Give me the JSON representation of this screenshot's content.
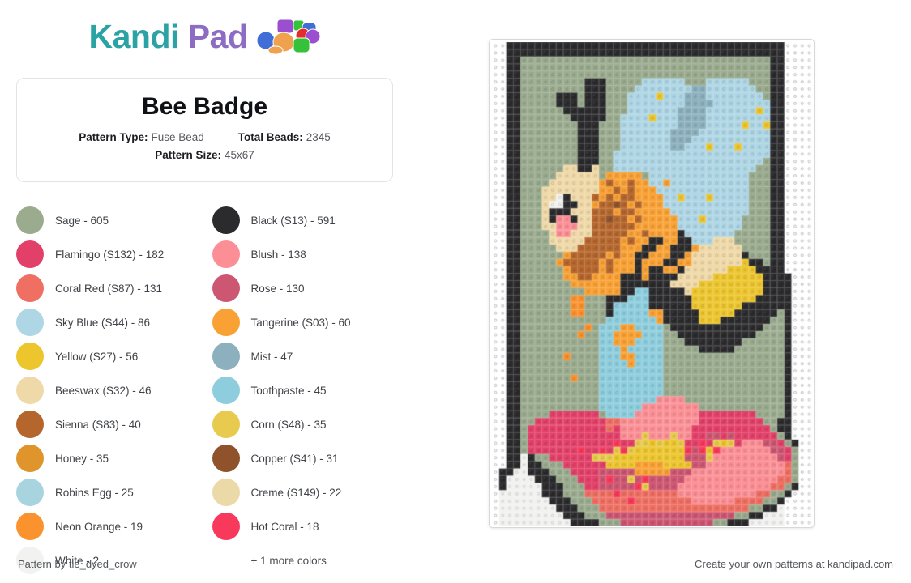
{
  "brand": {
    "name_part1": "Kandi",
    "name_part2": "Pad",
    "color_teal": "#2ba3a5",
    "color_purple": "#8d6dc4"
  },
  "info_card": {
    "title": "Bee Badge",
    "pattern_type_label": "Pattern Type:",
    "pattern_type_value": "Fuse Bead",
    "total_beads_label": "Total Beads:",
    "total_beads_value": "2345",
    "pattern_size_label": "Pattern Size:",
    "pattern_size_value": "45x67"
  },
  "legend": {
    "left": [
      {
        "name": "Sage - 605",
        "color": "#9aab8e"
      },
      {
        "name": "Flamingo (S132) - 182",
        "color": "#e34069"
      },
      {
        "name": "Coral Red (S87) - 131",
        "color": "#ef6f63"
      },
      {
        "name": "Sky Blue (S44) - 86",
        "color": "#aed6e5"
      },
      {
        "name": "Yellow (S27) - 56",
        "color": "#edc62e"
      },
      {
        "name": "Beeswax (S32) - 46",
        "color": "#f0d9a8"
      },
      {
        "name": "Sienna (S83) - 40",
        "color": "#b5662c"
      },
      {
        "name": "Honey - 35",
        "color": "#e0952c"
      },
      {
        "name": "Robins Egg - 25",
        "color": "#a8d4df"
      },
      {
        "name": "Neon Orange - 19",
        "color": "#fa922e"
      },
      {
        "name": "White - 2",
        "color": "#f2f2f0"
      }
    ],
    "right": [
      {
        "name": "Black (S13) - 591",
        "color": "#2b2b2d"
      },
      {
        "name": "Blush - 138",
        "color": "#fb8f95"
      },
      {
        "name": "Rose - 130",
        "color": "#cd5672"
      },
      {
        "name": "Tangerine (S03) - 60",
        "color": "#f9a134"
      },
      {
        "name": "Mist - 47",
        "color": "#8cb0bd"
      },
      {
        "name": "Toothpaste - 45",
        "color": "#8dcddd"
      },
      {
        "name": "Corn (S48) - 35",
        "color": "#e8cb4e"
      },
      {
        "name": "Copper (S41) - 31",
        "color": "#90522a"
      },
      {
        "name": "Creme (S149) - 22",
        "color": "#ecd9a8"
      },
      {
        "name": "Hot Coral - 18",
        "color": "#f9395c"
      }
    ],
    "more_colors": "+ 1 more colors"
  },
  "footer": {
    "left": "Pattern by tie_dyed_crow",
    "right": "Create your own patterns at kandipad.com"
  },
  "pattern": {
    "cols": 45,
    "rows": 67,
    "cell": 8.8,
    "palette": {
      ".": "#ffffff",
      "K": "#2b2b2d",
      "G": "#9aab8e",
      "B": "#aed6e5",
      "M": "#8cb0bd",
      "T": "#8dcddd",
      "R": "#a8d4df",
      "Y": "#edc62e",
      "C": "#e8cb4e",
      "O": "#f9a134",
      "N": "#fa922e",
      "H": "#e0952c",
      "S": "#b5662c",
      "P": "#90522a",
      "W": "#f0d9a8",
      "E": "#ecd9a8",
      "F": "#e34069",
      "L": "#fb8f95",
      "Z": "#cd5672",
      "D": "#ef6f63",
      "X": "#f9395c",
      "I": "#f2f2f0"
    },
    "grid": [
      "..KKKKKKKKKKKKKKKKKKKKKKKKKKKKKKKKKKKKKKK...",
      "..KKKKKKKKKKKKKKKKKKKKKKKKKKKKKKKKKKKKKKK...",
      "..KKGGGGGGGGGGGGGGGGGGGGGGGGGGGGGGGGGGGKK..",
      "..KKGGGGGGGGGGGGGGGGGGGGGGGGGGGGGGGGGGGKK..",
      "..KKGGGGGGGGGGGGGGGGGGGGGGGGGGGGGGGGGGGKK..",
      "..KKGGGGGGGGGKKKGGGGGBBBBBBGGGBBBBBBGGGKK..",
      "..KKGGGGGGGGGKKKGGGGBBBBBBBBMMBBBBBBBGGKK..",
      "..KKGGGGGKKKGKKKGGGBBBBYBBBMMMBBBBBBBBGKK..",
      "..KKGGGGGKKKGKKKGGGBBBBBBBBMMMMBBBBBBBBKK..",
      "..KKGGGGGGKKKKKKGGGBBBBBBBMMMMBBBBBBBYBKK..",
      "..KKGGGGGGGKKKKKGGBBBBYBBBMMMMBBBBBBBBBKK..",
      "..KKGGGGGGGGKKKGGGBBBBBBBBMMMMBBBBBYBBYKK..",
      "..KKGGGGGGGGKKKGGGBBBBBBBMMMMBBBBBBBBBBKK..",
      "..KKGGGGGGGGKKKGGGBBBBBBBMMMBBBBBBBBBBBKK..",
      "..KKGGGGGGGGKKKGGGBBBBBBBMMBBBYBBBYBBBBKK..",
      "..KKGGGGGGGGKKKGGBBBBBBBBBBBBBBBBBBBBBBKK..",
      "..KKGGGGGGGGKKKGGBBBBBBBBBBBBBBBBBBBBBGKK..",
      "..KKGGGGGGWWKKWGGBBBBBBBBBBBBBBBBBBBBGGKK..",
      "..KKGGGGGWWWWWWGOOOOOGBBBBBBBBBBBBBBGGGKK..",
      "..KKGGGGWWWWWWWOSOOSOOBBOBBBBBBBBBBBGGGKK..",
      "..KKGGGWWWWWWWWOOSOSOOOBBBBBBBBBBBBBGGGKK..",
      "..KKGGGWWIKWWWSOSOSSOOOOBBYBBBYBBBBBGGGKK..",
      "..KKGGGWIIKKWWOSSPSOSOOOBBBBBBBBBBBBGGGKK..",
      "..KKGGGWKKKWWWSSSOSSOOOOOBBBBBBBBBBBGGGKK..",
      "..KKGGGWKLLKWWSSPSSOSOOOOOBBBYBBBBBGGGGKK..",
      "..KKGGGWWLLLWWSSSSSSOOOOOOBBBBBBBBBGGGGKK..",
      "..KKGGGGWLLWWWSSSSSOOSOOOOKBBBBBBBGGGGGKK..",
      "..KKGGGGWWWWWSSSSSOSOOKKOOKKBBBWWWGGGGGKK..",
      "..KKGGGGGWWWSSSSSSOOOKKOOKKKOWWWWWWGGGGKK..",
      "..KKGGGGGGOSSSSSOSOOKKOOOKKOWWWWWWWKGGGKK..",
      "..KKGGGGGOSSSSSOSOOOKOOOKKOOWWWWWWWYKKGKK..",
      "..KKGGGGGGOSSSSOSOOOKOKKOOKWWWWWWYYYYKKKK..",
      "..KKGGGGGGOOSSOOOOKKKOKKKKWWWWWYYYYYYYKKKK.",
      "..KKGGGGGGGOOOOOOOKKKKKKKWWWWYYYYYYYYYKKKK.",
      "..KKGGGGGGGGGOOOOOKKTTKKKKKWYYYYYYYYYYKKKK.",
      "..KKGGGGGGGNNGGGKKKTTTKKKKKKYYYYYYYYYKKKKK.",
      "..KKGGGGGGGNNGGGKTTTTTKKKKKKYYYYYYYKKKKKKK.",
      "..KKGGGGGGGNNGGGKTTTTTOOKKKKKYYYYYKKKKKKGK.",
      "..KKGGGGGGGGGGGGTTTTTTTOKKKKKYYYKKKKKKKGGK.",
      "..KKGGGGGGGGGNGTTTOOTTTTGKKKKKKKKKKKKKGGGK.",
      "..KKGGGGGGGGNGGTTOOOOTTTGGKKKKKKKKKKKGGGGK.",
      "..KKGGGGGGGGGGGTTOOOTTTTGGGKKKKKKKKGGGGGGK.",
      "..KKGGGGGGGGGGGTTTOTTTTTGGGGGKKKKKGGGGGGGK.",
      "..KKGGGGGGNGGGGTTTOOTTTTGGGGGGGGGGGGGGGGGK.",
      "..KKGGGGGGGGGGGTTTTOTTTTGGGGGGGGGGGGGGGGGK.",
      "..KKGGGGGGGGGGGTTTTTTTTTGGGGGGGGGGGGGGGGGK.",
      "..KKGGGGGGGNGGGTTTTTTTTTGGGGGGGGGGGGGGGGGK.",
      "..KKGGGGGGGGGGGTTTTTTTTTGGGGGGGGGGGGGGGGGK.",
      "..KKGGGGGGGGGGGTTTTTTTTTGGGGGGGGGGGGGGGGGK.",
      "..KKGGGGGGGGGGGTTTTTTTTLLLLGGGGGGGGGGGGGGK.",
      "..KKGGGGGGGGGGGTTTTTTLLLLLLLLGGGGGGGGGGGGK.",
      "..KKGGGGFFFFFFFGTTTTLLLLLLLLLFFFFFFFFGGGGK.",
      "..KKGGFFFFFFFFFFDDLLLLLLLLLLLFFFFFFFFFGGKK.",
      "..KKGFFFFFFFFFFFDFLLLLLLLLLLFFFFFFFFFFFGKK.",
      "..KKGFFFFFFFFFFFFFLLLCLLLCLLFFZZFZFFFFFFGK.",
      "..KKGFFFFFFFFFFFFXFFCCYCYYCFFXFCYCFLLLZZFGK",
      "..KKGFFFFFFFXFFXFCXCYYYYYYYXZXYXLLLLLLLZZFG",
      "..KKIKGGFFFFFFCCCYYYYYYYYYYZZZCLLLLLLLLLZFG",
      "..KKIKKGGGFFFFFFYYYYOOOOYYYYZZLLLLLLLLLLLDG",
      ".KKIIKKKGGGFFFFZZZZZOOOOOZZZLLLLLLLLLLLLLDG",
      ".KIIIIKKKGGGFFFZXZZCZXZZZZZLLLLLLLLLLLLLDDG",
      ".KIIIIIKKKGGGFFZZZZZXCZZZZLLLLLLLLLLLLLDDGK",
      ".IIIIIIKKKGGGDDDDXDDDDDDDDLLLLLLLLLLLDDGGK.",
      ".IIIIIIIKKKGGGDDDDDXDDDDDDDDLLLLLLDDDDGGK..",
      ".IIIIIIIIKKKGGGDDDDDDDDDDDDDDDDDDDDDGGKKI..",
      ".IIIIIIIIIKKKGGGZZZZZZZZZZZZZZZZZZGGKKIII..",
      ".IIIIIIIIIIKKKKGGGZZZZZZZZZZZZZGGKKKIIIII.."
    ]
  }
}
